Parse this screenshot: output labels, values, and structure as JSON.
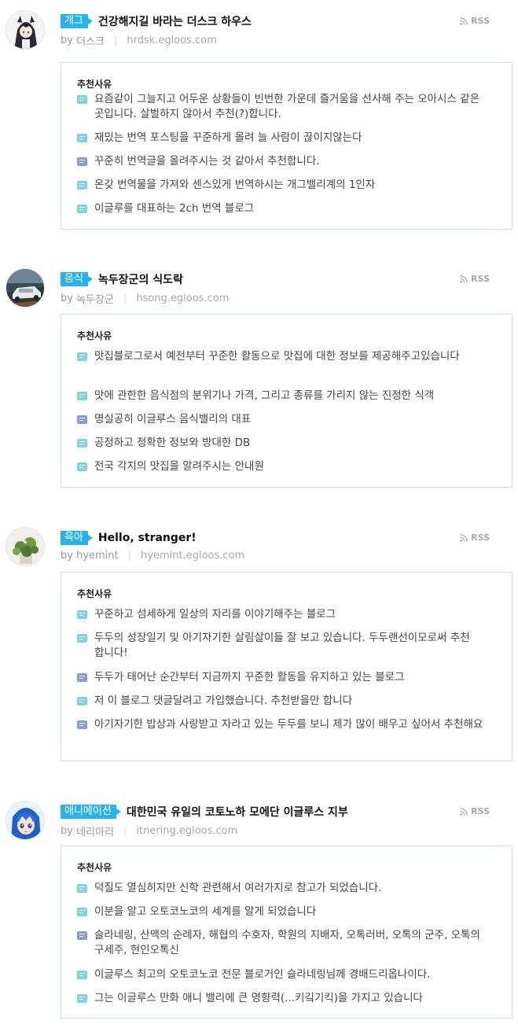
{
  "colors": {
    "category_bg": "#26b4f1",
    "icon_teal": "#7dd3e0",
    "icon_blue": "#8a9bd8",
    "box_border": "#cde3ec"
  },
  "blogs": [
    {
      "category": "개그",
      "title": "건강해지길 바라는 더스크 하우스",
      "rss": "RSS",
      "by": "by",
      "author": "더스크",
      "url": "hrdsk.egloos.com",
      "avatar": "anime-girl-avatar",
      "reason_label": "추천사유",
      "reasons": [
        {
          "text": "요즘같이 그늘지고 어두운 상황들이 빈번한 가운데 즐거움을 선사해 주는 오아시스 같은 곳입니다. 살벌하지 않아서 추천(?)합니다.",
          "icon": "teal"
        },
        {
          "text": "재밌는 번역 포스팅을 꾸준하게 올려 늘 사람이 끊이지않는다",
          "icon": "teal"
        },
        {
          "text": "꾸준히 번역글을 올려주시는 것 같아서 추천합니다.",
          "icon": "blue"
        },
        {
          "text": "온갖 번역물을 가져와 센스있게 번역하시는 개그밸리계의 1인자",
          "icon": "teal"
        },
        {
          "text": "이글루를 대표하는 2ch 번역 블로그",
          "icon": "teal"
        }
      ]
    },
    {
      "category": "음식",
      "title": "녹두장군의 식도락",
      "rss": "RSS",
      "by": "by",
      "author": "녹두장군",
      "url": "hsong.egloos.com",
      "avatar": "car-photo-avatar",
      "reason_label": "추천사유",
      "reasons": [
        {
          "text": "맛집블로그로서 예전부터 꾸준한 활동으로 맛집에 대한 정보를 제공해주고있습니다",
          "icon": "teal"
        },
        {
          "text": "맛에 관한한 음식점의 분위기나 가격, 그리고 종류를 가리지 않는 진정한 식객",
          "icon": "teal"
        },
        {
          "text": "명실공히 이글루스 음식밸리의 대표",
          "icon": "blue"
        },
        {
          "text": "공정하고 정확한 정보와 방대한 DB",
          "icon": "teal"
        },
        {
          "text": "전국 각지의 맛집을 알려주시는 안내원",
          "icon": "teal"
        }
      ]
    },
    {
      "category": "육아",
      "title": "Hello, stranger!",
      "rss": "RSS",
      "by": "by",
      "author": "hyemint",
      "url": "hyemint.egloos.com",
      "avatar": "plant-photo-avatar",
      "reason_label": "추천사유",
      "reasons": [
        {
          "text": "꾸준하고 섬세하게 일상의 자리를 이야기해주는 블로그",
          "icon": "teal"
        },
        {
          "text": "두두의 성장일기 및 아기자기한 살림살이들 잘 보고 있습니다. 두두랜선이모로써 추천 합니다!",
          "icon": "teal"
        },
        {
          "text": "두두가 태어난 순간부터 지금까지 꾸준한 활동을 유지하고 있는 블로그",
          "icon": "blue"
        },
        {
          "text": "저 이 블로그 댓글달려고 가입했습니다. 추천받을만 합니다",
          "icon": "teal"
        },
        {
          "text": "아기자기한 밥상과 사랑받고 자라고 있는 두두를 보니 제가 많이 배우고 싶어서 추천해요",
          "icon": "blue"
        }
      ]
    },
    {
      "category": "애니메이션",
      "title": "대한민국 유일의 코토노하 모에단 이글루스 지부",
      "rss": "RSS",
      "by": "by",
      "author": "네리아리",
      "url": "itnering.egloos.com",
      "avatar": "blue-hair-anime-avatar",
      "reason_label": "추천사유",
      "reasons": [
        {
          "text": "덕질도 열심히지만 신학 관련해서 여러가지로 참고가 되었습니다.",
          "icon": "teal"
        },
        {
          "text": "이분을 알고 오토코노코의 세계를 알게 되었습니다",
          "icon": "teal"
        },
        {
          "text": "슬라네링, 산맥의 순례자, 해협의 수호자, 학원의 지배자, 오톡러버, 오톡의 군주, 오톡의 구세주, 현인오톡신",
          "icon": "blue"
        },
        {
          "text": "이글루스 최고의 오토코노코 전문 블로거인 슬라네링님께 경배드리옵나이다.",
          "icon": "teal"
        },
        {
          "text": "그는 이글루스 만화 애니 밸리에 큰 영향력(...키깈기킥)을 가지고 있습니다",
          "icon": "teal"
        }
      ]
    }
  ]
}
